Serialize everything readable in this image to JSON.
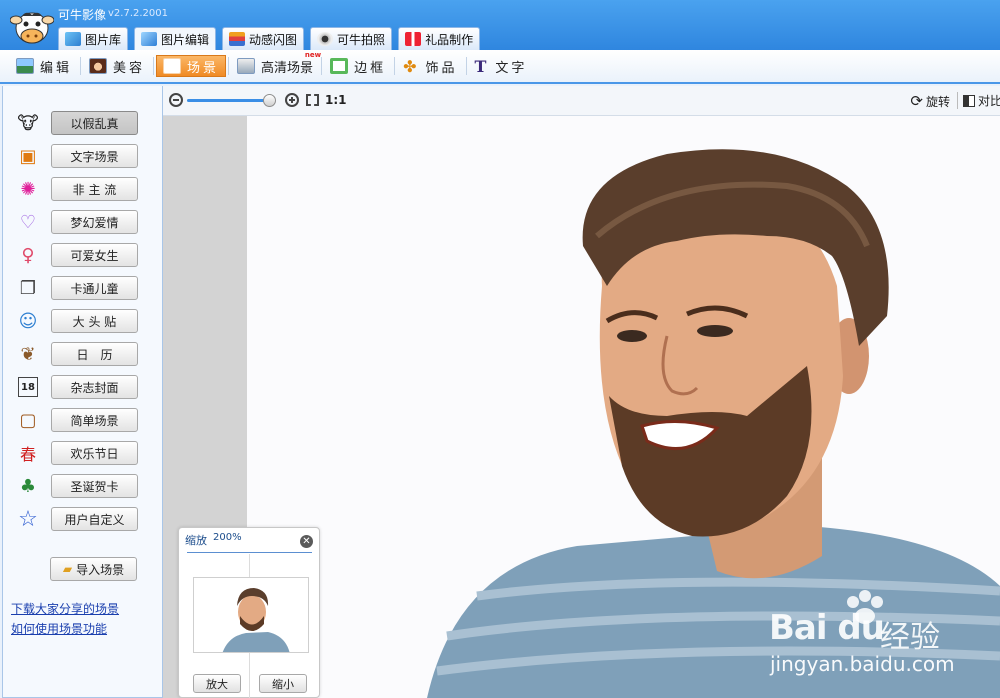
{
  "app": {
    "title": "可牛影像",
    "version": "v2.7.2.2001"
  },
  "main_tabs": [
    {
      "label": "图片库",
      "icon": "gallery-icon",
      "active": false
    },
    {
      "label": "图片编辑",
      "icon": "edit-image-icon",
      "active": true
    },
    {
      "label": "动感闪图",
      "icon": "flash-image-icon",
      "active": false
    },
    {
      "label": "可牛拍照",
      "icon": "webcam-icon",
      "active": false
    },
    {
      "label": "礼品制作",
      "icon": "gift-icon",
      "active": false
    }
  ],
  "sub_tabs": [
    {
      "label": "编辑",
      "icon": "edit-icon",
      "active": false
    },
    {
      "label": "美容",
      "icon": "beauty-icon",
      "active": false
    },
    {
      "label": "场景",
      "icon": "scene-icon",
      "active": true
    },
    {
      "label": "高清场景",
      "icon": "hd-scene-icon",
      "active": false,
      "badge": "new"
    },
    {
      "label": "边框",
      "icon": "frame-icon",
      "active": false
    },
    {
      "label": "饰品",
      "icon": "accessory-icon",
      "active": false
    },
    {
      "label": "文字",
      "icon": "text-icon",
      "active": false
    }
  ],
  "scene_categories": [
    {
      "label": "以假乱真",
      "icon": "cow-icon",
      "selected": true
    },
    {
      "label": "文字场景",
      "icon": "text-scene-icon",
      "selected": false
    },
    {
      "label": "非 主 流",
      "icon": "sparkle-icon",
      "selected": false
    },
    {
      "label": "梦幻爱情",
      "icon": "heart-icon",
      "selected": false
    },
    {
      "label": "可爱女生",
      "icon": "female-icon",
      "selected": false
    },
    {
      "label": "卡通儿童",
      "icon": "cartoon-book-icon",
      "selected": false
    },
    {
      "label": "大 头 贴",
      "icon": "photo-sticker-icon",
      "selected": false
    },
    {
      "label": "日　历",
      "icon": "calendar-elephant-icon",
      "selected": false
    },
    {
      "label": "杂志封面",
      "icon": "calendar-18-icon",
      "selected": false
    },
    {
      "label": "简单场景",
      "icon": "simple-frame-icon",
      "selected": false
    },
    {
      "label": "欢乐节日",
      "icon": "spring-festival-icon",
      "selected": false
    },
    {
      "label": "圣诞贺卡",
      "icon": "christmas-tree-icon",
      "selected": false
    },
    {
      "label": "用户自定义",
      "icon": "star-icon",
      "selected": false
    }
  ],
  "import_button": "导入场景",
  "links": [
    "下载大家分享的场景",
    "如何使用场景功能"
  ],
  "view_toolbar": {
    "ratio": "1:1",
    "rotate": "旋转",
    "compare": "对比"
  },
  "zoom_panel": {
    "title": "缩放",
    "percent": "200%",
    "zoom_in": "放大",
    "zoom_out": "缩小"
  },
  "zoom_level": 0.95,
  "watermark": {
    "brand": "Bai du",
    "cn": "经验",
    "url": "jingyan.baidu.com"
  }
}
